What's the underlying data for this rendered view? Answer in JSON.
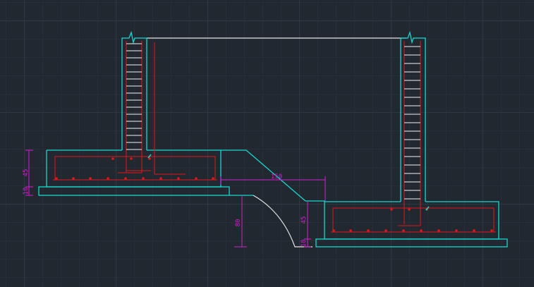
{
  "colors": {
    "background": "#212830",
    "outline": "#19d7d0",
    "rebar": "#e0161d",
    "dimension": "#d21ed2",
    "ground": "#e6e6e6"
  },
  "dimensions": {
    "left_height": "45",
    "left_base": "10",
    "slope_horizontal": "150",
    "depth": "80",
    "right_height": "45",
    "right_base": "10"
  }
}
